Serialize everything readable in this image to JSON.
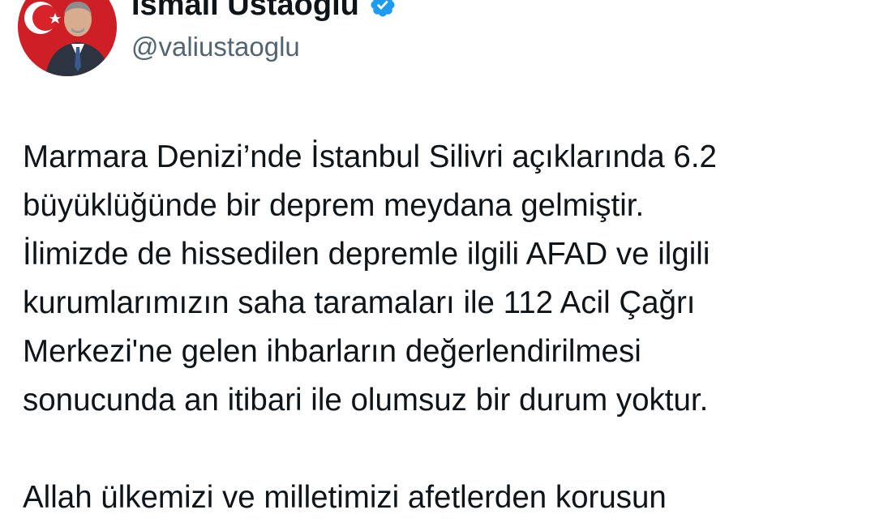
{
  "author": {
    "display_name": "İsmail Ustaoğlu",
    "handle": "@valiustaoglu",
    "verified": true,
    "avatar_icon": "profile-photo-with-turkish-flag"
  },
  "tweet": {
    "paragraph_1": [
      "Marmara Denizi’nde İstanbul Silivri açıklarında 6.2",
      "büyüklüğünde bir deprem meydana gelmiştir.",
      "İlimizde de hissedilen depremle ilgili AFAD ve ilgili",
      "kurumlarımızın saha taramaları ile 112 Acil Çağrı",
      "Merkezi'ne gelen ihbarların değerlendirilmesi",
      "sonucunda an itibari ile olumsuz bir durum yoktur."
    ],
    "paragraph_2": [
      "Allah ülkemizi ve milletimizi afetlerden korusun"
    ]
  },
  "colors": {
    "text": "#0f1419",
    "secondary_text": "#536471",
    "verified_badge": "#1d9bf0",
    "flag_red": "#e30a17"
  }
}
